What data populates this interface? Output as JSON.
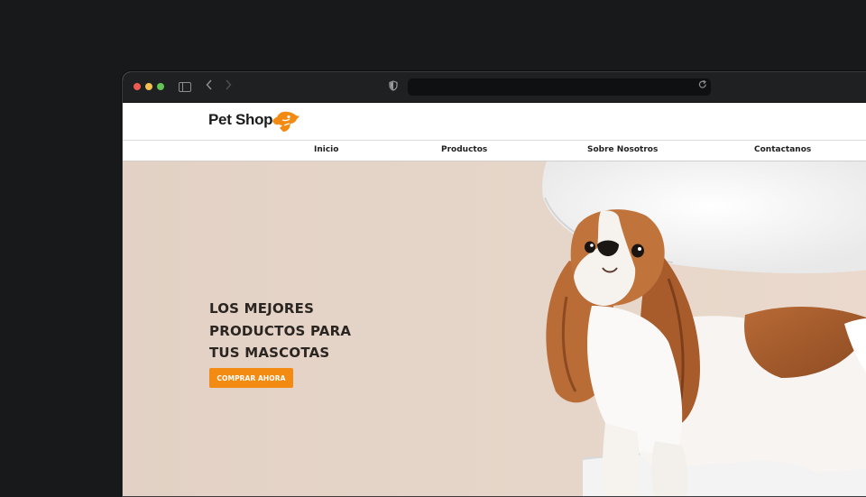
{
  "browser": {
    "icons": [
      "sidebar-icon",
      "back-arrow-icon",
      "forward-arrow-icon",
      "shield-icon",
      "reload-icon"
    ],
    "address": ""
  },
  "site": {
    "logo_text": "Pet Shop",
    "logo_icon": "dog-head-icon",
    "brand_color": "#f38a12"
  },
  "nav": {
    "items": [
      "Inicio",
      "Productos",
      "Sobre Nosotros",
      "Contactanos"
    ]
  },
  "hero": {
    "title_lines": [
      "LOS MEJORES",
      "PRODUCTOS PARA",
      "TUS MASCOTAS"
    ],
    "cta_label": "COMPRAR AHORA",
    "image": "cavalier-king-charles-spaniel-on-white-chair"
  }
}
